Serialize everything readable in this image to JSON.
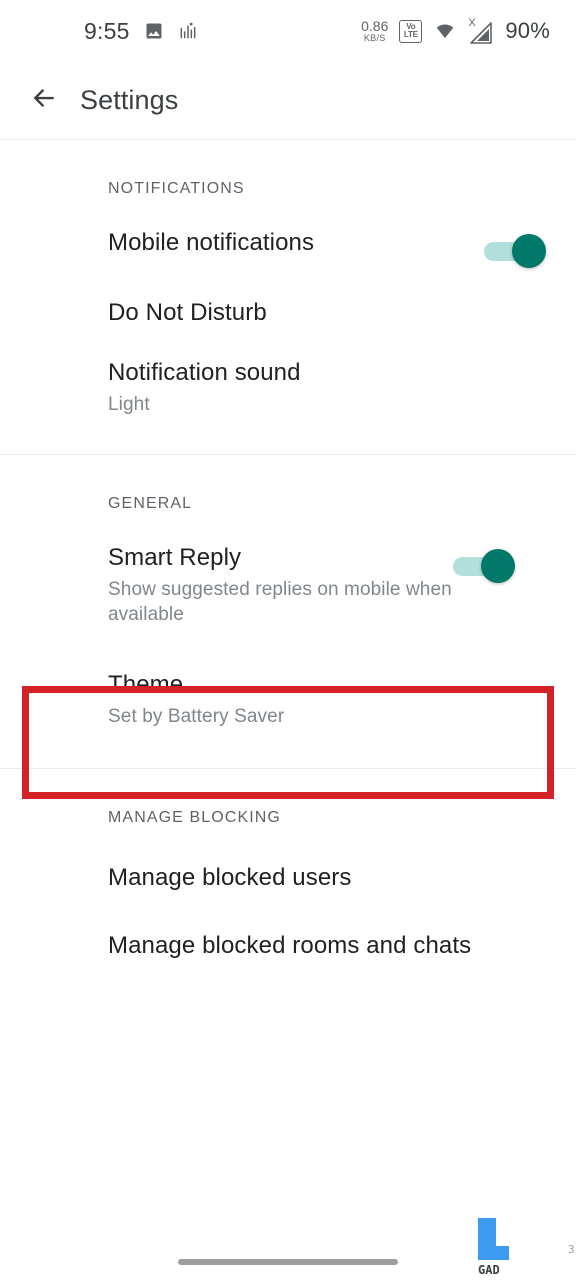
{
  "status_bar": {
    "time": "9:55",
    "left_icons": [
      {
        "name": "image-icon",
        "label": "image"
      },
      {
        "name": "chart-activity-icon",
        "label": "activity"
      }
    ],
    "network_speed_value": "0.86",
    "network_speed_unit": "KB/S",
    "volte_line1": "Vo",
    "volte_line2": "LTE",
    "wifi_icon": "wifi-icon",
    "signal_icon": "cellular-signal-icon",
    "signal_badge": "X",
    "battery_percent": "90%"
  },
  "app_bar": {
    "back_icon": "back-arrow-icon",
    "title": "Settings"
  },
  "sections": [
    {
      "header": "NOTIFICATIONS",
      "rows": [
        {
          "title": "Mobile notifications",
          "subtitle": "",
          "control": "switch",
          "switch_on": true
        },
        {
          "title": "Do Not Disturb",
          "subtitle": "",
          "control": "none"
        },
        {
          "title": "Notification sound",
          "subtitle": "Light",
          "control": "none"
        }
      ]
    },
    {
      "header": "GENERAL",
      "rows": [
        {
          "title": "Smart Reply",
          "subtitle": "Show suggested replies on mobile when available",
          "control": "switch",
          "switch_on": true
        },
        {
          "title": "Theme",
          "subtitle": "Set by Battery Saver",
          "control": "none",
          "highlighted": true
        }
      ]
    },
    {
      "header": "MANAGE BLOCKING",
      "rows": [
        {
          "title": "Manage blocked users",
          "subtitle": "",
          "control": "none"
        },
        {
          "title": "Manage blocked rooms and chats",
          "subtitle": "",
          "control": "none"
        }
      ]
    }
  ],
  "watermark": {
    "text": "GAD",
    "edge_text": "3",
    "color": "#3d9bef"
  },
  "annotation": {
    "color": "#d42027",
    "target": "Theme"
  },
  "colors": {
    "switch_thumb": "#00796b",
    "switch_track": "#b2dfdb",
    "title_text": "#202124",
    "subtitle_text": "#80868b",
    "divider": "#ebebeb",
    "nav_pill": "#9e9e9e"
  }
}
